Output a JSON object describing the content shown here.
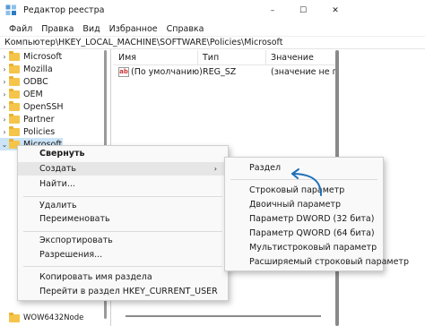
{
  "window": {
    "title": "Редактор реестра",
    "minimize": "–",
    "maximize": "☐",
    "close": "✕"
  },
  "menu": [
    "Файл",
    "Правка",
    "Вид",
    "Избранное",
    "Справка"
  ],
  "address": "Компьютер\\HKEY_LOCAL_MACHINE\\SOFTWARE\\Policies\\Microsoft",
  "tree": {
    "items": [
      "Microsoft",
      "Mozilla",
      "ODBC",
      "OEM",
      "OpenSSH",
      "Partner",
      "Policies"
    ],
    "selected": "Microsoft",
    "partial_bottom": "WOW6432Node"
  },
  "list": {
    "headers": {
      "name": "Имя",
      "type": "Тип",
      "value": "Значение"
    },
    "rows": [
      {
        "icon": "ab",
        "name": "(По умолчанию)",
        "type": "REG_SZ",
        "value": "(значение не при"
      }
    ]
  },
  "context_menu": {
    "items": [
      {
        "label": "Свернуть",
        "bold": true
      },
      {
        "label": "Создать",
        "submenu": true,
        "arrow": "›",
        "hover": true
      },
      {
        "label": "Найти..."
      },
      {
        "label": "Удалить"
      },
      {
        "label": "Переименовать"
      },
      {
        "label": "Экспортировать"
      },
      {
        "label": "Разрешения..."
      },
      {
        "label": "Копировать имя раздела"
      },
      {
        "label": "Перейти в раздел HKEY_CURRENT_USER"
      }
    ]
  },
  "submenu": {
    "items": [
      "Раздел",
      "Строковый параметр",
      "Двоичный параметр",
      "Параметр DWORD (32 бита)",
      "Параметр QWORD (64 бита)",
      "Мультистроковый параметр",
      "Расширяемый строковый параметр"
    ]
  },
  "colors": {
    "accent_arrow": "#1e6fb8",
    "selection": "#cce4f7",
    "folder": "#f4c54a"
  }
}
